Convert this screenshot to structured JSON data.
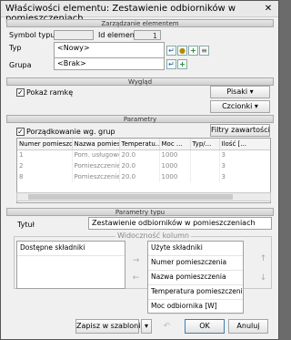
{
  "window": {
    "title": "Właściwości elementu: Zestawienie odbiorników w pomieszczeniach",
    "close": "✕"
  },
  "sections": {
    "management": "Zarządzanie elementem",
    "appearance": "Wygląd",
    "parameters": "Parametry",
    "type_parameters": "Parametry typu",
    "column_visibility": "Widoczność kolumn"
  },
  "management": {
    "symbol_label": "Symbol typu",
    "symbol_value": "",
    "id_label": "Id elementu",
    "id_value": "1",
    "type_label": "Typ",
    "type_value": "<Nowy>",
    "group_label": "Grupa",
    "group_value": "<Brak>"
  },
  "appearance": {
    "show_frame_label": "Pokaż ramkę",
    "show_frame_checked": true,
    "pens_button": "Pisaki",
    "fonts_button": "Czcionki"
  },
  "parameters": {
    "group_sort_label": "Porządkowanie wg. grup",
    "group_sort_checked": true,
    "content_filters_button": "Filtry zawartości",
    "table": {
      "columns": [
        "Numer pomieszczenia",
        "Nazwa pomies...",
        "Temperatu...",
        "Moc ...",
        "Typ/...",
        "Ilość [..."
      ],
      "rows": [
        [
          "1",
          "Pom. usługowe",
          "20.0",
          "1000",
          "",
          "3"
        ],
        [
          "2",
          "Pomieszczenie",
          "20.0",
          "1000",
          "",
          "3"
        ],
        [
          "8",
          "Pomieszczenie",
          "20.0",
          "1000",
          "",
          "3"
        ]
      ]
    }
  },
  "type_params": {
    "title_label": "Tytuł",
    "title_value": "Zestawienie odbiorników w pomieszczeniach",
    "available_header": "Dostępne składniki",
    "used_items": [
      "Użyte składniki",
      "Numer pomieszczenia",
      "Nazwa pomieszczenia",
      "Temperatura pomieszczenia ti [",
      "Moc odbiornika [W]"
    ]
  },
  "footer": {
    "save_template": "Zapisz w szablonie",
    "ok": "OK",
    "cancel": "Anuluj"
  }
}
